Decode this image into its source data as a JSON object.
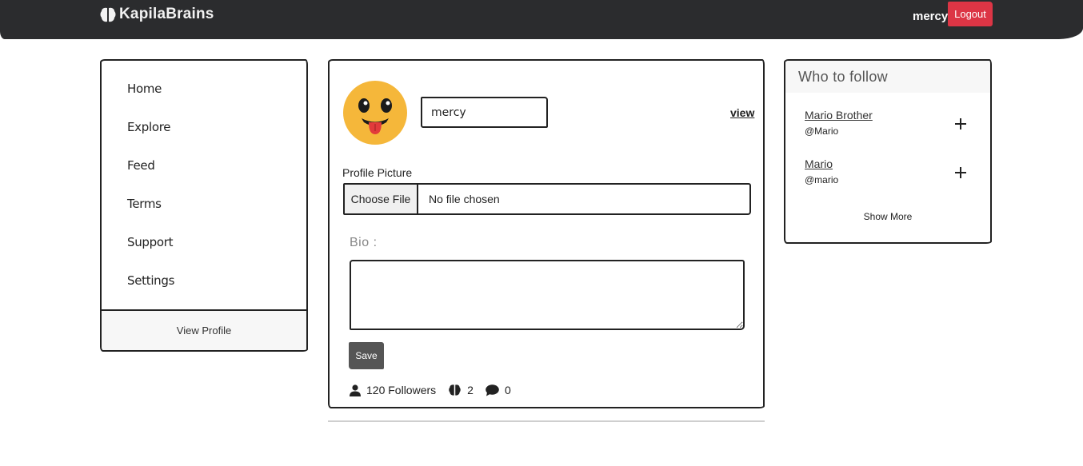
{
  "navbar": {
    "brand_icon": "brain-icon",
    "brand_name": "KapilaBrains",
    "username": "mercy",
    "logout_label": "Logout",
    "bg_color": "#2b2c2e",
    "logout_color": "#dc3545"
  },
  "sidebar": {
    "items": [
      {
        "label": "Home"
      },
      {
        "label": "Explore"
      },
      {
        "label": "Feed"
      },
      {
        "label": "Terms"
      },
      {
        "label": "Support"
      },
      {
        "label": "Settings"
      }
    ],
    "footer_label": "View Profile"
  },
  "profile": {
    "avatar_icon": "tongue-out-emoji-icon",
    "username_value": "mercy",
    "view_link": "view",
    "picture_label": "Profile Picture",
    "choose_file_label": "Choose File",
    "file_status": "No file chosen",
    "bio_label": "Bio :",
    "bio_value": "",
    "save_label": "Save",
    "stats": {
      "followers": "120 Followers",
      "brains": "2",
      "comments": "0"
    }
  },
  "who_to_follow": {
    "title": "Who to follow",
    "users": [
      {
        "name": "Mario Brother",
        "handle": "@Mario"
      },
      {
        "name": "Mario",
        "handle": "@mario"
      }
    ],
    "add_icon": "plus-icon",
    "show_more": "Show More"
  }
}
